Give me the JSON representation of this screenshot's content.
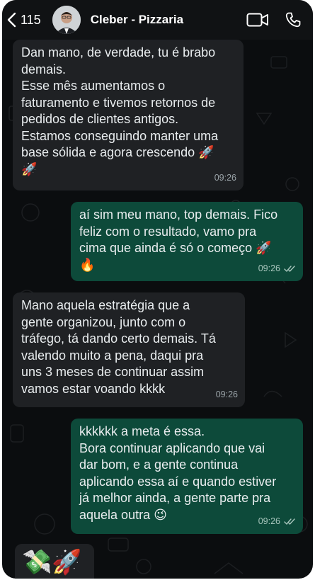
{
  "header": {
    "back_count": "115",
    "contact_name": "Cleber - Pizzaria",
    "icons": [
      "chevron-left-icon",
      "video-camera-icon",
      "phone-icon"
    ]
  },
  "messages": [
    {
      "direction": "incoming",
      "text": "Dan mano, de verdade, tu é brabo\ndemais.\nEsse mês aumentamos o\nfaturamento e tivemos retornos de\npedidos de clientes antigos.\nEstamos conseguindo manter uma\nbase sólida e agora crescendo 🚀\n🚀",
      "time": "09:26"
    },
    {
      "direction": "outgoing",
      "text": "aí sim meu mano, top demais. Fico\nfeliz com o resultado, vamo pra\ncima que ainda é só o começo 🚀\n🔥",
      "time": "09:26",
      "status": "read"
    },
    {
      "direction": "incoming",
      "text": "Mano aquela estratégia que a\ngente organizou, junto com o\ntráfego, tá dando certo demais. Tá\nvalendo muito a pena, daqui pra\nuns 3 meses de continuar assim\nvamos estar voando kkkk",
      "time": "09:26"
    },
    {
      "direction": "outgoing",
      "text": "kkkkkk a meta é essa.\nBora continuar aplicando que vai\ndar bom, e a gente continua\naplicando essa aí e quando estiver\njá melhor ainda, a gente parte pra\naquela outra 😉",
      "time": "09:26",
      "status": "read"
    },
    {
      "direction": "incoming",
      "text": "💸🚀"
    }
  ],
  "colors": {
    "incoming_bubble": "#1f2124",
    "outgoing_bubble": "#0d4a3a",
    "background": "#0b0d0f"
  }
}
